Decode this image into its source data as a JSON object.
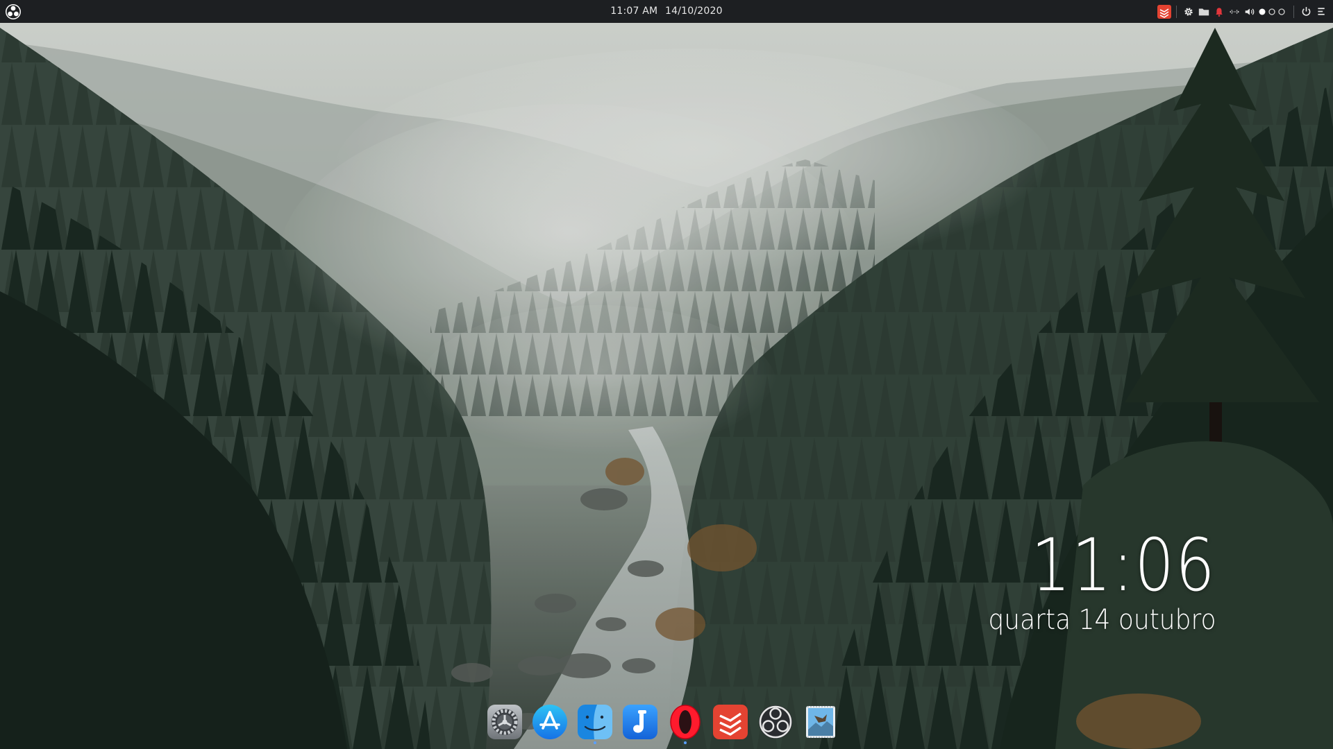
{
  "panel": {
    "time": "11:07 AM",
    "date": "14/10/2020"
  },
  "tray_icons": [
    "todoist-icon",
    "settings-gear-icon",
    "folder-icon",
    "notification-bell-icon",
    "network-icon",
    "volume-icon",
    "workspace-indicator-icon",
    "power-icon",
    "menu-icon"
  ],
  "widget": {
    "time": "11:06",
    "date": "quarta 14 outubro"
  },
  "dock": {
    "items": [
      {
        "name": "system-preferences-icon",
        "running": false
      },
      {
        "name": "app-store-icon",
        "running": false
      },
      {
        "name": "finder-icon",
        "running": true
      },
      {
        "name": "music-player-icon",
        "running": false
      },
      {
        "name": "opera-browser-icon",
        "running": true
      },
      {
        "name": "todoist-icon",
        "running": false
      },
      {
        "name": "obs-studio-icon",
        "running": false
      },
      {
        "name": "image-viewer-icon",
        "running": false
      }
    ]
  },
  "colors": {
    "panel_bg": "#1d1f22",
    "accent_red": "#e44332",
    "running_indicator": "#5aa0ff"
  }
}
